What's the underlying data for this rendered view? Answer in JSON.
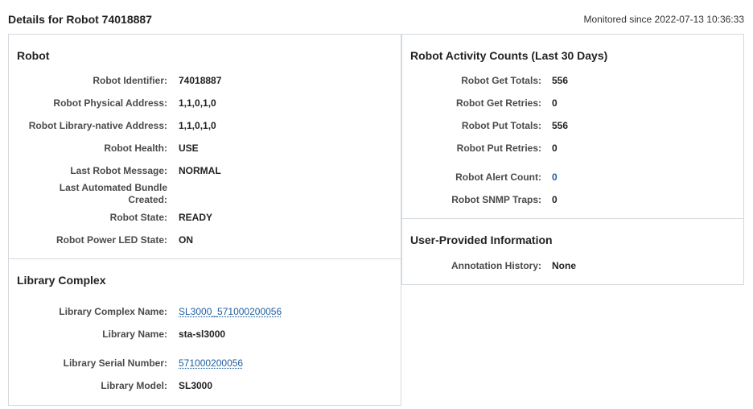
{
  "header": {
    "title": "Details for Robot 74018887",
    "monitored": "Monitored since 2022-07-13 10:36:33"
  },
  "robot": {
    "heading": "Robot",
    "fields": [
      {
        "label": "Robot Identifier:",
        "value": "74018887"
      },
      {
        "label": "Robot Physical Address:",
        "value": "1,1,0,1,0"
      },
      {
        "label": "Robot Library-native Address:",
        "value": "1,1,0,1,0"
      },
      {
        "label": "Robot Health:",
        "value": "USE"
      },
      {
        "label": "Last Robot Message:",
        "value": "NORMAL"
      },
      {
        "label_line1": "Last Automated Bundle",
        "label_line2": "Created:",
        "value": ""
      },
      {
        "label": "Robot State:",
        "value": "READY"
      },
      {
        "label": "Robot Power LED State:",
        "value": "ON"
      }
    ]
  },
  "library_complex": {
    "heading": "Library Complex",
    "fields": [
      {
        "label": "Library Complex Name:",
        "value": "SL3000_571000200056"
      },
      {
        "label": "Library Name:",
        "value": "sta-sl3000"
      },
      {
        "label": "Library Serial Number:",
        "value": "571000200056"
      },
      {
        "label": "Library Model:",
        "value": "SL3000"
      }
    ]
  },
  "activity": {
    "heading": "Robot Activity Counts (Last 30 Days)",
    "fields": [
      {
        "label": "Robot Get Totals:",
        "value": "556"
      },
      {
        "label": "Robot Get Retries:",
        "value": "0"
      },
      {
        "label": "Robot Put Totals:",
        "value": "556"
      },
      {
        "label": "Robot Put Retries:",
        "value": "0"
      },
      {
        "label": "Robot Alert Count:",
        "value": "0"
      },
      {
        "label": "Robot SNMP Traps:",
        "value": "0"
      }
    ]
  },
  "user_info": {
    "heading": "User-Provided Information",
    "fields": [
      {
        "label": "Annotation History:",
        "value": "None"
      }
    ]
  }
}
